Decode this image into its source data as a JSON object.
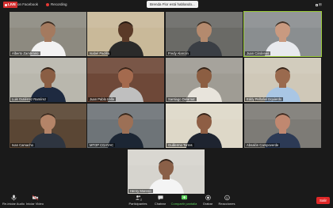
{
  "topbar": {
    "live_label": "LIVE",
    "facebook_label": "on Facebook",
    "recording_label": "Recording",
    "talking_label": "Brenda Flor está hablando..."
  },
  "participants": [
    {
      "name": "Alberto Zambrano",
      "bg": "#8d8a80",
      "shirt": "#f2f2f2",
      "skin": "#a47a5f"
    },
    {
      "name": "Isabel Padilla",
      "bg": "#c9b999",
      "shirt": "#2a2a2a",
      "skin": "#5a3a28"
    },
    {
      "name": "Fredy Alarcón",
      "bg": "#6a6a66",
      "shirt": "#3a3e44",
      "skin": "#b48a6e"
    },
    {
      "name": "Juan Cárdenas",
      "bg": "#8a8e90",
      "shirt": "#e8eaee",
      "skin": "#c99a80"
    },
    {
      "name": "Luis Gutiérrez Ramírez",
      "bg": "#b9b7ad",
      "shirt": "#1e2a40",
      "skin": "#8a5e44"
    },
    {
      "name": "Juan Pablo Irelle",
      "bg": "#6e4838",
      "shirt": "#bfbfbf",
      "skin": "#a46a4e"
    },
    {
      "name": "Santiago Delarout",
      "bg": "#9f9c94",
      "shirt": "#e8e4dc",
      "skin": "#8c5e42"
    },
    {
      "name": "Eddy Peñafiel Izquierdo",
      "bg": "#cfc8b8",
      "shirt": "#a9c6e4",
      "skin": "#9a6a4e"
    },
    {
      "name": "Ivan Camacho",
      "bg": "#5a4634",
      "shirt": "#2e3540",
      "skin": "#b48468"
    },
    {
      "name": "MTOP CGAYAC",
      "bg": "#6e7478",
      "shirt": "#1c2634",
      "skin": "#9c7056"
    },
    {
      "name": "Guillermo Torres",
      "bg": "#ded8c8",
      "shirt": "#1e2430",
      "skin": "#8e5e44"
    },
    {
      "name": "Absalón Campoverde",
      "bg": "#7d7b76",
      "shirt": "#2c3a55",
      "skin": "#c08870"
    },
    {
      "name": "Henry Moreno",
      "bg": "#d6d4ce",
      "shirt": "#f4f4f4",
      "skin": "#8a6048"
    }
  ],
  "controls": {
    "mute_label": "Re-iniciar Audio",
    "video_label": "Iniciar Video",
    "participants_label": "Participantes",
    "chat_label": "Chatear",
    "share_label": "Compartir pantalla",
    "record_label": "Grabar",
    "reactions_label": "Reacciones",
    "leave_label": "Salir",
    "participant_count": "13"
  },
  "colors": {
    "active_speaker": "#9ccc3a",
    "leave": "#e02828",
    "share": "#5fd35f"
  }
}
